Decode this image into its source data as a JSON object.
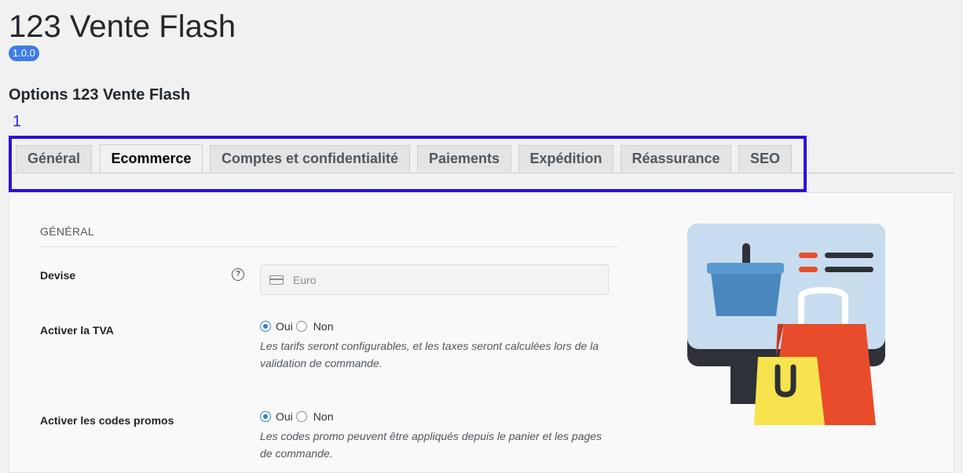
{
  "app": {
    "title": "123 Vente Flash",
    "version": "1.0.0"
  },
  "page": {
    "section_title": "Options 123 Vente Flash",
    "annotation_number": "1"
  },
  "tabs": [
    {
      "label": "Général",
      "active": false
    },
    {
      "label": "Ecommerce",
      "active": true
    },
    {
      "label": "Comptes et confidentialité",
      "active": false
    },
    {
      "label": "Paiements",
      "active": false
    },
    {
      "label": "Expédition",
      "active": false
    },
    {
      "label": "Réassurance",
      "active": false
    },
    {
      "label": "SEO",
      "active": false
    }
  ],
  "form": {
    "group_heading": "GÉNÉRAL",
    "currency": {
      "label": "Devise",
      "value": "Euro",
      "icon": "credit-card-icon",
      "help_icon": "question-icon"
    },
    "vat": {
      "label": "Activer la TVA",
      "options": [
        "Oui",
        "Non"
      ],
      "selected": "Oui",
      "description": "Les tarifs seront configurables, et les taxes seront calculées lors de la validation de commande."
    },
    "promo": {
      "label": "Activer les codes promos",
      "options": [
        "Oui",
        "Non"
      ],
      "selected": "Oui",
      "description": "Les codes promo peuvent être appliqués depuis le panier et les pages de commande."
    }
  },
  "colors": {
    "accent": "#3582c4",
    "badge": "#3d7ce6",
    "annotation": "#2b10dc"
  }
}
